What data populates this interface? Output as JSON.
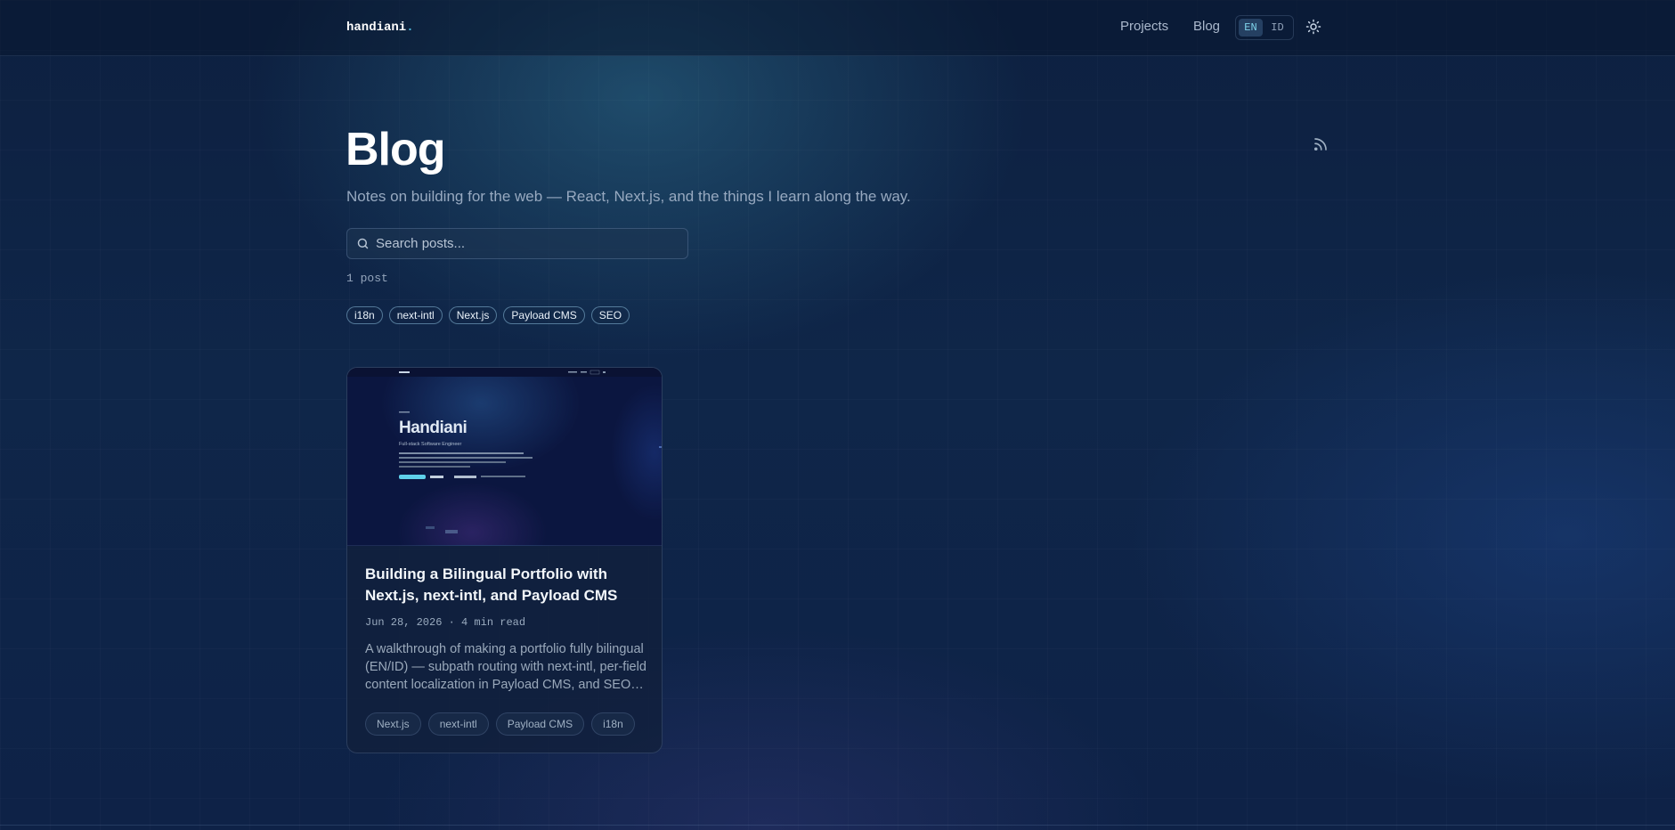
{
  "brand": {
    "name": "handiani",
    "dot": "."
  },
  "nav": {
    "projects": "Projects",
    "blog": "Blog",
    "lang": {
      "en": "EN",
      "id": "ID",
      "active": "EN"
    },
    "theme_icon": "sun-icon"
  },
  "page": {
    "title": "Blog",
    "subtitle": "Notes on building for the web — React, Next.js, and the things I learn along the way.",
    "rss_icon": "rss-icon"
  },
  "search": {
    "placeholder": "Search posts...",
    "value": ""
  },
  "count": "1 post",
  "tags": [
    "i18n",
    "next-intl",
    "Next.js",
    "Payload CMS",
    "SEO"
  ],
  "posts": [
    {
      "title": "Building a Bilingual Portfolio with Next.js, next-intl, and Payload CMS",
      "date": "Jun 28, 2026",
      "separator": "·",
      "read_time": "4 min read",
      "excerpt": "A walkthrough of making a portfolio fully bilingual (EN/ID) — subpath routing with next-intl, per-field content localization in Payload CMS, and SEO that works in both languages.",
      "tags": [
        "Next.js",
        "next-intl",
        "Payload CMS",
        "i18n"
      ],
      "thumbnail": {
        "heading": "Handiani",
        "role": "Full-stack Software Engineer"
      }
    }
  ],
  "colors": {
    "accent": "#4fb6d6",
    "background": "#0f2649",
    "text": "#ffffff",
    "muted": "#97a9c0"
  }
}
